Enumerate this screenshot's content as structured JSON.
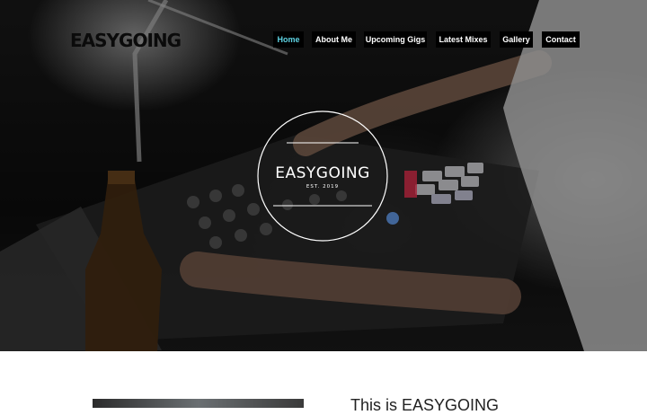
{
  "site": {
    "logo_text": "EASYGOING"
  },
  "nav": {
    "items": [
      {
        "label": "Home",
        "active": true
      },
      {
        "label": "About Me",
        "active": false
      },
      {
        "label": "Upcoming Gigs",
        "active": false
      },
      {
        "label": "Latest Mixes",
        "active": false
      },
      {
        "label": "Gallery",
        "active": false
      },
      {
        "label": "Contact",
        "active": false
      }
    ],
    "active_color": "#5ed3e3"
  },
  "hero": {
    "badge_title": "EASYGOING",
    "badge_subtitle": "EST. 2019"
  },
  "intro": {
    "title": "This is EASYGOING"
  }
}
